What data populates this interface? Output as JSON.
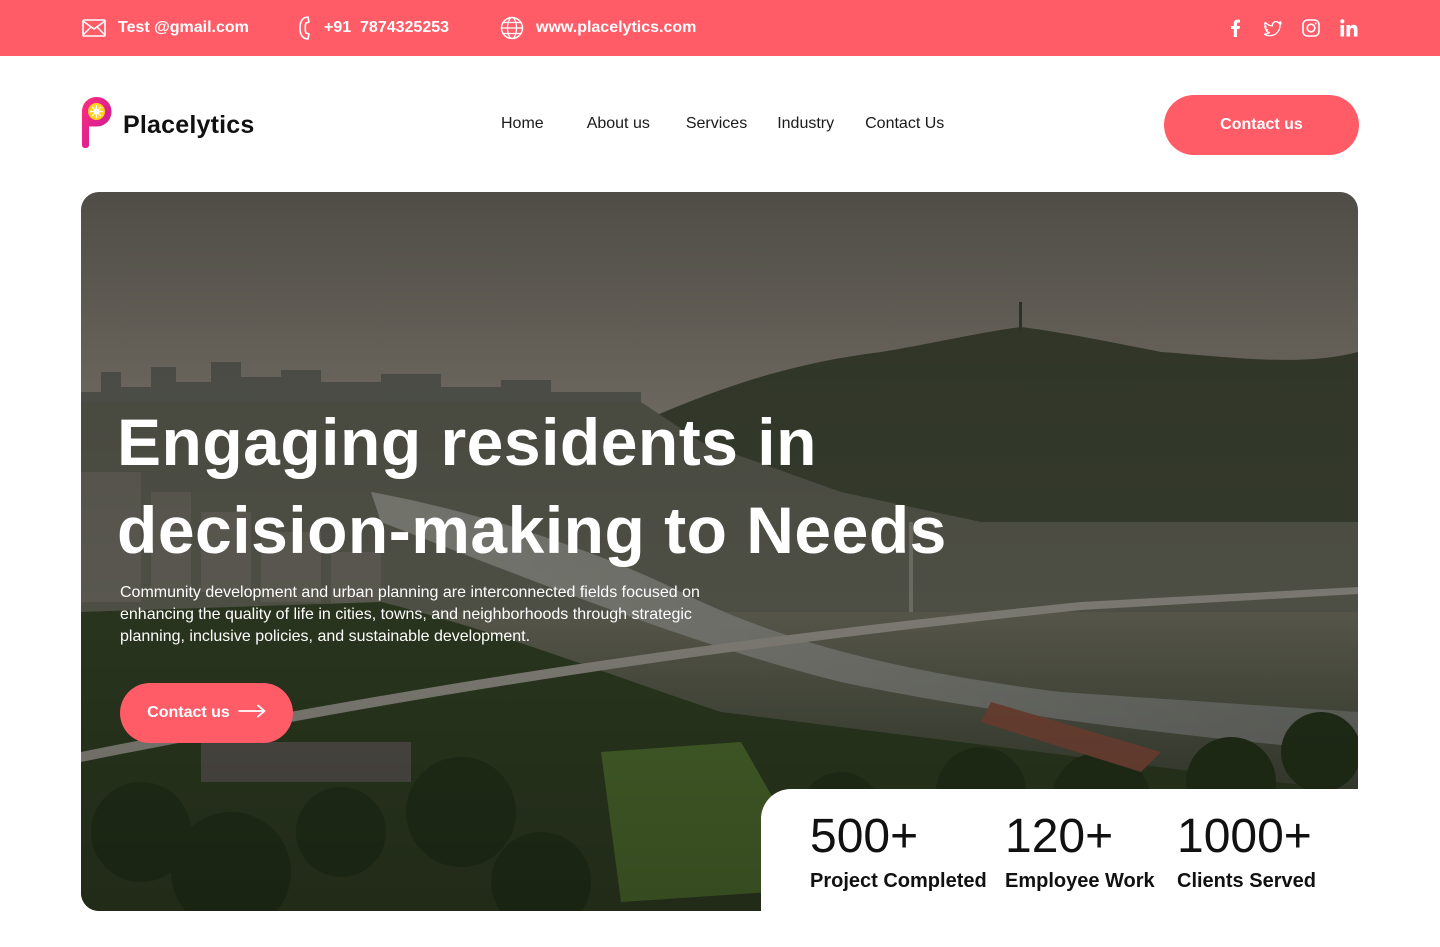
{
  "topbar": {
    "email": "Test @gmail.com",
    "phone": "+91  7874325253",
    "website": "www.placelytics.com",
    "icons": [
      "mail-icon",
      "phone-icon",
      "globe-icon",
      "facebook-icon",
      "twitter-icon",
      "instagram-icon",
      "linkedin-icon"
    ]
  },
  "header": {
    "brand": "Placelytics",
    "nav": [
      "Home",
      "About us",
      "Services",
      "Industry",
      "Contact Us"
    ],
    "cta": "Contact us"
  },
  "hero": {
    "title_line1": "Engaging residents in",
    "title_line2": "decision-making to Needs",
    "description": "Community development and urban planning are interconnected fields focused on enhancing the quality of life in cities, towns, and neighborhoods through strategic planning, inclusive policies, and sustainable development.",
    "cta": "Contact us"
  },
  "stats": [
    {
      "value": "500+",
      "label": "Project Completed"
    },
    {
      "value": "120+",
      "label": "Employee Work"
    },
    {
      "value": "1000+",
      "label": "Clients Served"
    }
  ],
  "colors": {
    "accent": "#ff5c68",
    "text": "#111111",
    "background": "#ffffff"
  }
}
